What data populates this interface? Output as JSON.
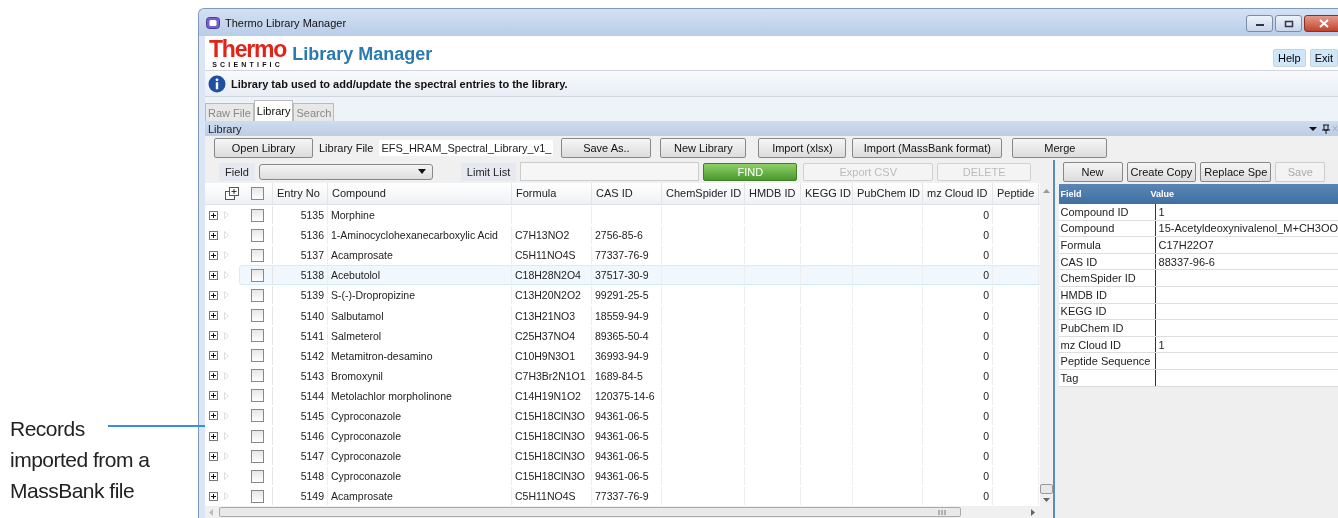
{
  "window": {
    "title": "Thermo Library Manager"
  },
  "header": {
    "brand": "Thermo",
    "brand_sub": "SCIENTIFIC",
    "app_name": "Library Manager",
    "buttons": [
      "Help",
      "Exit"
    ]
  },
  "info_bar": {
    "message": "Library tab used to add/update the spectral entries to the library."
  },
  "tabs": [
    {
      "label": "Raw File",
      "selected": false
    },
    {
      "label": "Library",
      "selected": true
    },
    {
      "label": "Search",
      "selected": false
    }
  ],
  "panel": {
    "title": "Library"
  },
  "toolbar": [
    {
      "kind": "button",
      "label": "Open Library"
    },
    {
      "kind": "label",
      "label": "Library File"
    },
    {
      "kind": "field",
      "label": "EFS_HRAM_Spectral_Library_v1_"
    },
    {
      "kind": "button",
      "label": "Save As.."
    },
    {
      "kind": "button",
      "label": "New Library"
    },
    {
      "kind": "button",
      "label": "Import (xlsx)"
    },
    {
      "kind": "button",
      "label": "Import (MassBank format)"
    },
    {
      "kind": "button",
      "label": "Merge"
    }
  ],
  "filter": {
    "field_label": "Field",
    "limit_label": "Limit List",
    "buttons": [
      {
        "label": "FIND",
        "kind": "primary",
        "disabled": false
      },
      {
        "label": "Export CSV",
        "kind": "normal",
        "disabled": true
      },
      {
        "label": "DELETE",
        "kind": "normal",
        "disabled": true
      }
    ]
  },
  "grid": {
    "select_all": {
      "checked": false
    },
    "columns": [
      "Entry No",
      "Compound",
      "Formula",
      "CAS ID",
      "ChemSpider ID",
      "HMDB ID",
      "KEGG ID",
      "PubChem ID",
      "mz Cloud ID",
      "Peptide"
    ],
    "rows": [
      {
        "entry": "5135",
        "compound": "Morphine",
        "mz_cloud": "0",
        "selected": false
      },
      {
        "entry": "5136",
        "compound": "1-Aminocyclohexanecarboxylic Acid",
        "formula": "C7H13NO2",
        "cas": "2756-85-6",
        "mz_cloud": "0",
        "selected": false
      },
      {
        "entry": "5137",
        "compound": "Acamprosate",
        "formula": "C5H11NO4S",
        "cas": "77337-76-9",
        "mz_cloud": "0",
        "selected": false
      },
      {
        "entry": "5138",
        "compound": "Acebutolol",
        "formula": "C18H28N2O4",
        "cas": "37517-30-9",
        "mz_cloud": "0",
        "selected": true
      },
      {
        "entry": "5139",
        "compound": "S-(-)-Dropropizine",
        "formula": "C13H20N2O2",
        "cas": "99291-25-5",
        "mz_cloud": "0",
        "selected": false
      },
      {
        "entry": "5140",
        "compound": "Salbutamol",
        "formula": "C13H21NO3",
        "cas": "18559-94-9",
        "mz_cloud": "0",
        "selected": false
      },
      {
        "entry": "5141",
        "compound": "Salmeterol",
        "formula": "C25H37NO4",
        "cas": "89365-50-4",
        "mz_cloud": "0",
        "selected": false
      },
      {
        "entry": "5142",
        "compound": "Metamitron-desamino",
        "formula": "C10H9N3O1",
        "cas": "36993-94-9",
        "mz_cloud": "0",
        "selected": false
      },
      {
        "entry": "5143",
        "compound": "Bromoxynil",
        "formula": "C7H3Br2N1O1",
        "cas": "1689-84-5",
        "mz_cloud": "0",
        "selected": false
      },
      {
        "entry": "5144",
        "compound": "Metolachlor morpholinone",
        "formula": "C14H19N1O2",
        "cas": "120375-14-6",
        "mz_cloud": "0",
        "selected": false
      },
      {
        "entry": "5145",
        "compound": "Cyproconazole",
        "formula": "C15H18ClN3O",
        "cas": "94361-06-5",
        "mz_cloud": "0",
        "selected": false
      },
      {
        "entry": "5146",
        "compound": "Cyproconazole",
        "formula": "C15H18ClN3O",
        "cas": "94361-06-5",
        "mz_cloud": "0",
        "selected": false
      },
      {
        "entry": "5147",
        "compound": "Cyproconazole",
        "formula": "C15H18ClN3O",
        "cas": "94361-06-5",
        "mz_cloud": "0",
        "selected": false
      },
      {
        "entry": "5148",
        "compound": "Cyproconazole",
        "formula": "C15H18ClN3O",
        "cas": "94361-06-5",
        "mz_cloud": "0",
        "selected": false
      },
      {
        "entry": "5149",
        "compound": "Acamprosate",
        "formula": "C5H11NO4S",
        "cas": "77337-76-9",
        "mz_cloud": "0",
        "selected": false
      }
    ]
  },
  "details": {
    "buttons": [
      {
        "label": "New",
        "disabled": false
      },
      {
        "label": "Create Copy",
        "disabled": false
      },
      {
        "label": "Replace Spe",
        "disabled": false
      },
      {
        "label": "Save",
        "disabled": true
      }
    ],
    "columns": [
      "Field",
      "Value"
    ],
    "rows": [
      {
        "field": "Compound ID",
        "value": "1"
      },
      {
        "field": "Compound",
        "value": "15-Acetyldeoxynivalenol_M+CH3OO"
      },
      {
        "field": "Formula",
        "value": "C17H22O7"
      },
      {
        "field": "CAS ID",
        "value": "88337-96-6"
      },
      {
        "field": "ChemSpider ID"
      },
      {
        "field": "HMDB ID"
      },
      {
        "field": "KEGG ID"
      },
      {
        "field": "PubChem ID"
      },
      {
        "field": "mz Cloud ID",
        "value": "1"
      },
      {
        "field": "Peptide Sequence"
      },
      {
        "field": "Tag"
      }
    ]
  },
  "annotation": {
    "text": "Records imported from a MassBank file"
  }
}
